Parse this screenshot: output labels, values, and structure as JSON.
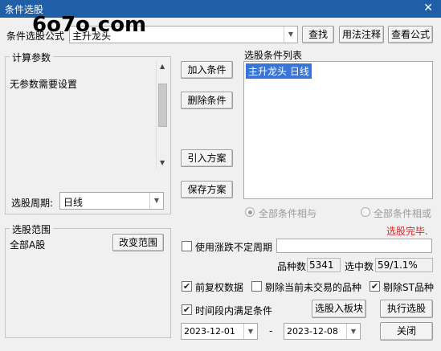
{
  "window": {
    "title": "条件选股",
    "close_glyph": "✕"
  },
  "watermark": "6o7o.com",
  "top": {
    "condition_label": "条件选股公式",
    "condition_value": "主升龙头",
    "find_btn": "查找",
    "usage_btn": "用法注释",
    "view_formula_btn": "查看公式"
  },
  "params": {
    "group_title": "计算参数",
    "no_params_text": "无参数需要设置",
    "period_label": "选股周期:",
    "period_value": "日线"
  },
  "actions": {
    "add_condition": "加入条件",
    "delete_condition": "删除条件",
    "import_plan": "引入方案",
    "save_plan": "保存方案"
  },
  "condition_list": {
    "title": "选股条件列表",
    "items": [
      "主升龙头  日线"
    ]
  },
  "logic": {
    "all_and": "全部条件相与",
    "all_or": "全部条件相或",
    "selected": "all_and"
  },
  "status": {
    "text": "选股完毕.",
    "color": "#e0252a"
  },
  "range": {
    "group_title": "选股范围",
    "value": "全部A股",
    "change_btn": "改变范围"
  },
  "options": {
    "variable_period_label": "使用涨跌不定周期",
    "variable_period_checked": false,
    "variable_period_value": "",
    "count_label": "品种数",
    "count_value": "5341",
    "selected_label": "选中数",
    "selected_value": "59/1.1%",
    "forward_adjust_label": "前复权数据",
    "forward_adjust_checked": true,
    "exclude_untraded_label": "剔除当前未交易的品种",
    "exclude_untraded_checked": false,
    "exclude_st_label": "剔除ST品种",
    "exclude_st_checked": true,
    "time_range_label": "时间段内满足条件",
    "time_range_checked": true,
    "start_date": "2023-12-01",
    "dash": "-",
    "end_date": "2023-12-08"
  },
  "bottom": {
    "add_to_block_btn": "选股入板块",
    "execute_btn": "执行选股",
    "close_btn": "关闭"
  }
}
